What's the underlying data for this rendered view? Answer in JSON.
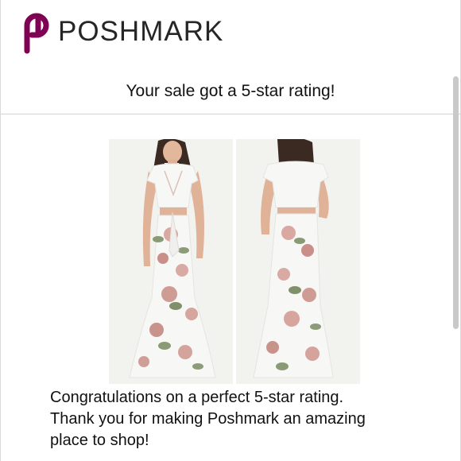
{
  "brand": {
    "logo_text": "POSHMARK",
    "logo_icon": "poshmark-logo-icon",
    "brand_color": "#7f0353"
  },
  "email": {
    "subject": "Your sale got a 5-star rating!",
    "message_lines": [
      "Congratulations on a perfect 5-star rating.",
      "Thank you for making Poshmark an amazing",
      "place to shop!"
    ]
  },
  "product_photos": [
    {
      "view": "front",
      "icon": "product-photo-front"
    },
    {
      "view": "back",
      "icon": "product-photo-back"
    }
  ]
}
